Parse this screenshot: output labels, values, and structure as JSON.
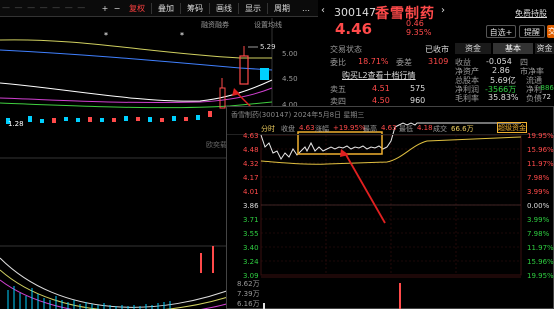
{
  "toolbar": {
    "plus_label": "+",
    "minus_label": "−",
    "right_label": "复权",
    "overlay_label": "叠加",
    "avg_label": "筹码",
    "draw_label": "画线",
    "display_label": "显示",
    "cycle_label": "周期",
    "more_label": "…",
    "financing_label": "融资融券",
    "setting_label": "设置均线"
  },
  "stock": {
    "code": "300147",
    "name": "香雪制药",
    "price": "4.46",
    "change": "0.46",
    "change_pct": "9.35%",
    "account_label": "免费持股"
  },
  "actions": {
    "self_select": "自选",
    "plus_icon": "+",
    "remind": "提醒",
    "trade": "交"
  },
  "panel": {
    "tab_funds": "资金",
    "tab_basic": "基本",
    "status_label": "交易状态",
    "status_value": "已收市",
    "wei_bi_label": "委比",
    "wei_bi_value": "18.71%",
    "wei_cha_label": "委差",
    "wei_cha_value": "3109",
    "level2_label": "购买L2查看十档行情",
    "sell5_label": "卖五",
    "sell5_price": "4.51",
    "sell5_vol": "575",
    "sell4_label": "卖四",
    "sell4_price": "4.50",
    "sell4_vol": "960",
    "eps_label": "收益",
    "eps_value": "-0.054",
    "eps_unit": "四",
    "nav_label": "净资产",
    "nav_value": "2.86",
    "roe_label": "市净率",
    "total_cap_label": "总股本",
    "total_cap_value": "5.69亿",
    "float_label": "流通",
    "net_profit_label": "净利润",
    "net_profit_value": "-3566万",
    "net_profit2_label": "净利",
    "gross_margin_label": "毛利率",
    "gross_margin_value": "35.83%",
    "gross_margin2_label": "负债",
    "right_edge1": "-886",
    "right_edge2": "72"
  },
  "daily": {
    "high_label": "5.29",
    "ylabels": [
      "5.00",
      "4.50",
      "4.00"
    ],
    "low_label": "1.28",
    "watermark": "欧奕载"
  },
  "popup": {
    "title": "香雪制药(300147) 2024年5月8日 星期三",
    "tab_label": "分时",
    "prev_close_label": "收盘",
    "prev_close_value": "4.63",
    "change_pct_label": "涨幅",
    "change_pct_value": "+19.95%",
    "high_label": "最高",
    "high_value": "4.63",
    "low_label": "最低",
    "low_value": "4.18",
    "vol_label": "成交",
    "vol_value": "66.6万",
    "button_label": "超级资金",
    "left_scale": [
      "4.63",
      "4.48",
      "4.32",
      "4.17",
      "4.01",
      "3.86",
      "3.71",
      "3.55",
      "3.40",
      "3.24",
      "3.09"
    ],
    "right_scale": [
      "19.95%",
      "15.96%",
      "11.97%",
      "7.98%",
      "3.99%",
      "0.00%",
      "3.99%",
      "7.98%",
      "11.97%",
      "15.96%",
      "19.95%"
    ],
    "vol_scale": [
      "8.62万",
      "7.39万",
      "6.16万"
    ]
  },
  "colors": {
    "up": "#ff4a4a",
    "down": "#2ecc40",
    "highlight": "#f0b030",
    "cyan": "#00e0ff"
  }
}
